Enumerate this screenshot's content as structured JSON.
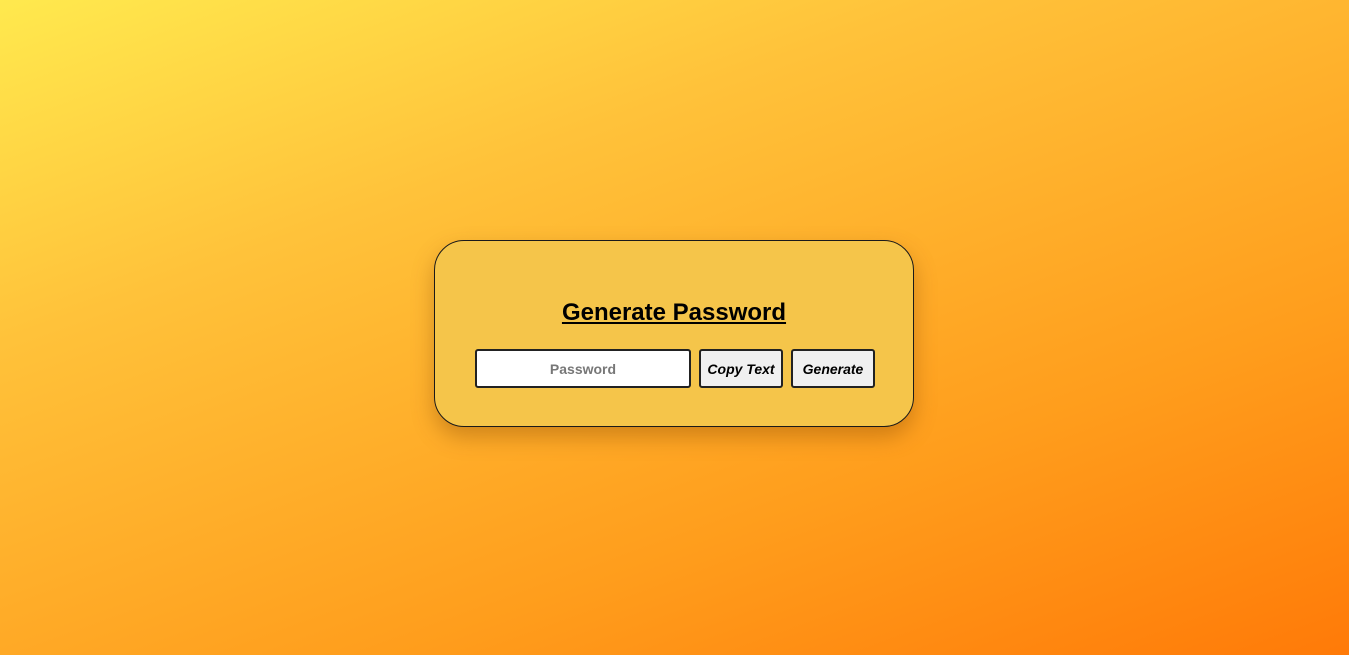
{
  "card": {
    "title": "Generate Password",
    "password_field": {
      "placeholder": "Password",
      "value": ""
    },
    "copy_button_label": "Copy Text",
    "generate_button_label": "Generate"
  },
  "colors": {
    "background_gradient_start": "#ffe94e",
    "background_gradient_end": "#ff7a08",
    "card_background": "#f5c54a",
    "button_background": "#f0f0f0"
  }
}
